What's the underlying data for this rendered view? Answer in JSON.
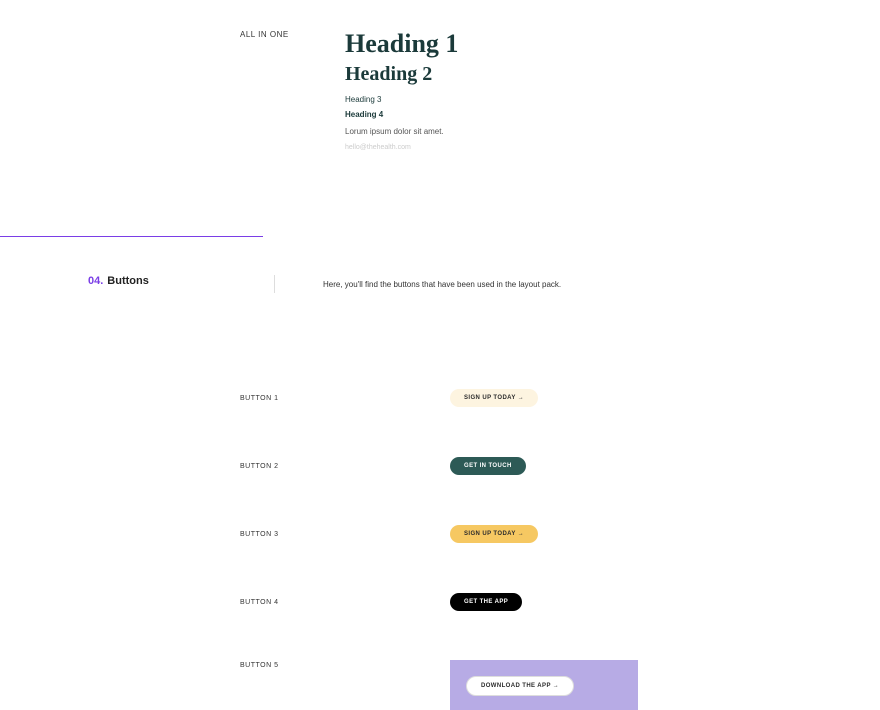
{
  "top": {
    "label": "ALL IN ONE",
    "h1": "Heading 1",
    "h2": "Heading 2",
    "h3": "Heading 3",
    "h4": "Heading 4",
    "body": "Lorum ipsum dolor sit amet.",
    "link": "hello@thehealth.com"
  },
  "section": {
    "num": "04.",
    "title": "Buttons",
    "desc": "Here, you'll find the buttons that have been used in the layout pack."
  },
  "buttons": {
    "row1": {
      "label": "BUTTON 1",
      "text": "SIGN UP TODAY →"
    },
    "row2": {
      "label": "BUTTON 2",
      "text": "GET IN TOUCH"
    },
    "row3": {
      "label": "BUTTON 3",
      "text": "SIGN UP TODAY →"
    },
    "row4": {
      "label": "BUTTON 4",
      "text": "GET THE APP"
    },
    "row5": {
      "label": "BUTTON 5",
      "text": "DOWNLOAD THE APP →"
    }
  }
}
